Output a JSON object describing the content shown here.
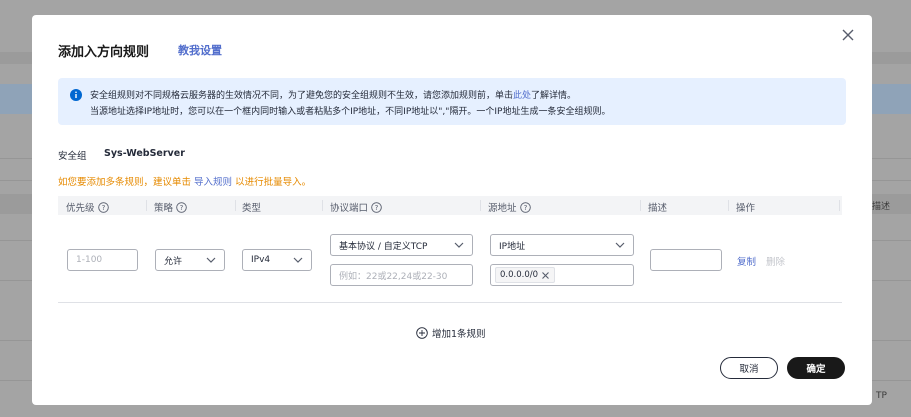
{
  "background": {
    "right_header": "描述",
    "right_cell": "TP"
  },
  "modal": {
    "title": "添加入方向规则",
    "tutorial_link": "教我设置",
    "info": {
      "line1_pre": "安全组规则对不同规格云服务器的生效情况不同，为了避免您的安全组规则不生效，请您添加规则前，单击",
      "line1_link": "此处",
      "line1_post": "了解详情。",
      "line2": "当源地址选择IP地址时，您可以在一个框内同时输入或者粘贴多个IP地址，不同IP地址以\",\"隔开。一个IP地址生成一条安全组规则。"
    },
    "security_group": {
      "label": "安全组",
      "value": "Sys-WebServer"
    },
    "hint": {
      "pre": "如您要添加多条规则，建议单击 ",
      "link": "导入规则",
      "post": " 以进行批量导入。"
    },
    "columns": {
      "priority": "优先级",
      "policy": "策略",
      "type": "类型",
      "protocol_port": "协议端口",
      "source": "源地址",
      "description": "描述",
      "operation": "操作"
    },
    "row": {
      "priority_placeholder": "1-100",
      "policy": "允许",
      "type": "IPv4",
      "protocol": "基本协议 / 自定义TCP",
      "port_placeholder": "例如：22或22,24或22-30",
      "source_type": "IP地址",
      "source_tag": "0.0.0.0/0",
      "description_value": "",
      "copy": "复制",
      "delete": "删除"
    },
    "add_rule": "增加1条规则",
    "cancel": "取消",
    "confirm": "确定"
  },
  "colors": {
    "link": "#526ecc",
    "warning": "#e68a00",
    "banner_bg": "#e6f0ff",
    "primary_button": "#191919"
  }
}
